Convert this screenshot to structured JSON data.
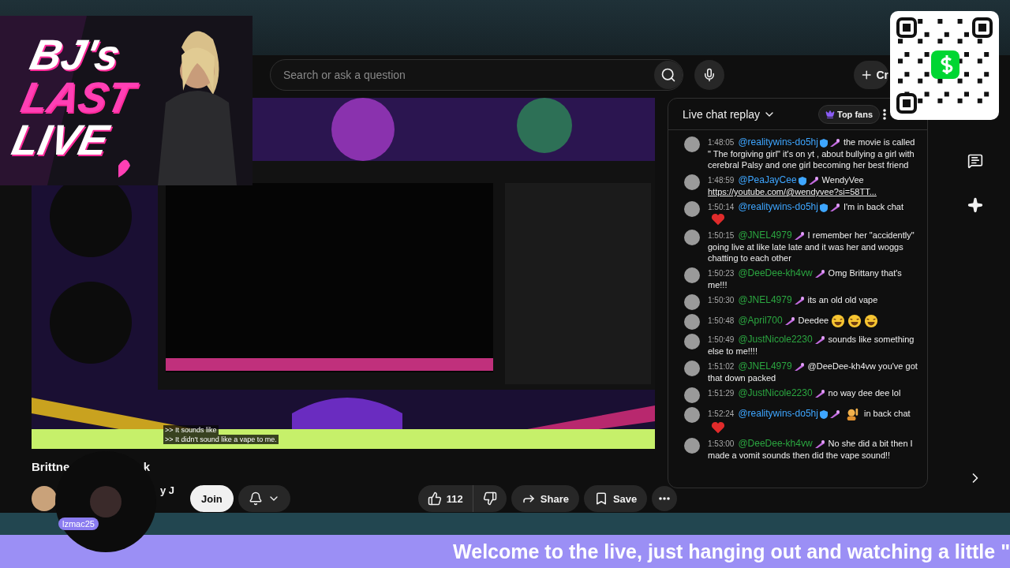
{
  "overlay_logo": {
    "lines": [
      "BJ's",
      "LAST",
      "LIVE"
    ]
  },
  "search": {
    "placeholder": "Search or ask a question"
  },
  "create_button": {
    "label": "Cr"
  },
  "video": {
    "kind": "picture",
    "captions": [
      ">> It sounds like",
      ">> It didn't sound like a vape to me."
    ]
  },
  "title_parts": [
    "Brittne",
    "k"
  ],
  "channel_name": "y J",
  "actions": {
    "join": "Join",
    "likes": "112",
    "share": "Share",
    "save": "Save"
  },
  "chat": {
    "title": "Live chat replay",
    "filter": "Top fans",
    "messages": [
      {
        "time": "1:48:05",
        "author": "@realitywins-do5hj",
        "color": "#3ea6ff",
        "verified": true,
        "text": "the movie is called \" The forgiving girl\" it's on yt , about bullying a girl with cerebral Palsy and one girl becoming her best friend"
      },
      {
        "time": "1:48:59",
        "author": "@PeaJayCee",
        "color": "#3ea6ff",
        "verified": true,
        "text": "WendyVee",
        "link": "https://youtube.com/@wendyvee?si=58TT..."
      },
      {
        "time": "1:50:14",
        "author": "@realitywins-do5hj",
        "color": "#3ea6ff",
        "verified": true,
        "text": "I'm in back chat",
        "emojis_after": [
          {
            "kind": "heart"
          }
        ]
      },
      {
        "time": "1:50:15",
        "author": "@JNEL4979",
        "color": "#2ba640",
        "verified": false,
        "text": "I remember her \"accidently\" going live at like late late and it was her and woggs chatting to each other"
      },
      {
        "time": "1:50:23",
        "author": "@DeeDee-kh4vw",
        "color": "#2ba640",
        "verified": false,
        "text": "Omg Brittany that's me!!!"
      },
      {
        "time": "1:50:30",
        "author": "@JNEL4979",
        "color": "#2ba640",
        "verified": false,
        "text": "its an old old vape"
      },
      {
        "time": "1:50:48",
        "author": "@April700",
        "color": "#2ba640",
        "verified": false,
        "text": "Deedee",
        "emojis_after": [
          {
            "kind": "laugh"
          },
          {
            "kind": "laugh"
          },
          {
            "kind": "laugh"
          }
        ]
      },
      {
        "time": "1:50:49",
        "author": "@JustNicole2230",
        "color": "#2ba640",
        "verified": false,
        "text": "sounds like something else to me!!!!"
      },
      {
        "time": "1:51:02",
        "author": "@JNEL4979",
        "color": "#2ba640",
        "verified": false,
        "text": "@DeeDee-kh4vw you've got that down packed"
      },
      {
        "time": "1:51:29",
        "author": "@JustNicole2230",
        "color": "#2ba640",
        "verified": false,
        "text": "no way dee dee lol"
      },
      {
        "time": "1:52:24",
        "author": "@realitywins-do5hj",
        "color": "#3ea6ff",
        "verified": true,
        "emojis_before": [
          {
            "kind": "hand"
          }
        ],
        "text": "in back chat",
        "emojis_after": [
          {
            "kind": "heart"
          }
        ]
      },
      {
        "time": "1:53:00",
        "author": "@DeeDee-kh4vw",
        "color": "#2ba640",
        "verified": false,
        "text": "No she did a bit then I made a vomit sounds then did the vape sound!!"
      }
    ]
  },
  "cam_bubble": {
    "name": "lzmac25"
  },
  "banner": {
    "text": "Welcome to the live, just hanging out and watching a little \""
  }
}
